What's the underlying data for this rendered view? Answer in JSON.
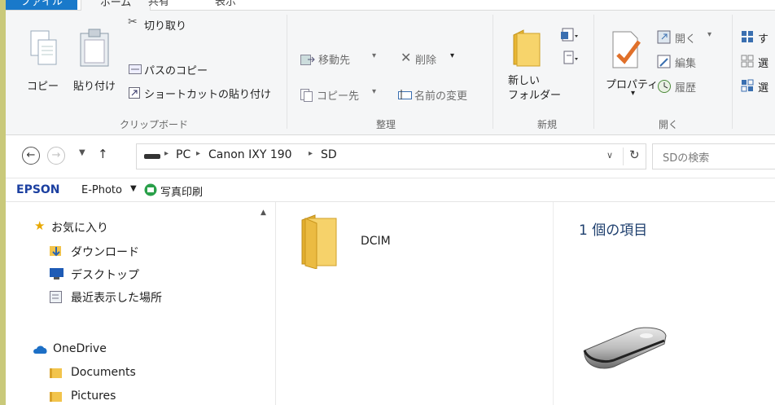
{
  "tabs": {
    "file": "ファイル",
    "home": "ホーム",
    "share": "共有",
    "view": "表示"
  },
  "ribbon": {
    "clipboard": {
      "copy": "コピー",
      "paste": "貼り付け",
      "cut": "切り取り",
      "copy_path": "パスのコピー",
      "paste_shortcut": "ショートカットの貼り付け",
      "group": "クリップボード"
    },
    "organize": {
      "move_to": "移動先",
      "copy_to": "コピー先",
      "delete": "削除",
      "rename": "名前の変更",
      "group": "整理"
    },
    "new": {
      "new_folder_line1": "新しい",
      "new_folder_line2": "フォルダー",
      "group": "新規"
    },
    "open": {
      "properties": "プロパティ",
      "open": "開く",
      "edit": "編集",
      "history": "履歴",
      "group": "開く"
    },
    "select": {
      "select_all": "す",
      "select_none": "選",
      "invert": "選"
    }
  },
  "address": {
    "path": [
      "PC",
      "Canon IXY 190",
      "SD"
    ],
    "search_placeholder": "SDの検索"
  },
  "epson": {
    "brand": "EPSON",
    "app": "E-Photo",
    "action": "写真印刷"
  },
  "nav": {
    "favorites_title": "お気に入り",
    "favorites": [
      "ダウンロード",
      "デスクトップ",
      "最近表示した場所"
    ],
    "onedrive_title": "OneDrive",
    "onedrive": [
      "Documents",
      "Pictures"
    ]
  },
  "content": {
    "items": [
      {
        "name": "DCIM"
      }
    ]
  },
  "details": {
    "count": "1 個の項目"
  }
}
